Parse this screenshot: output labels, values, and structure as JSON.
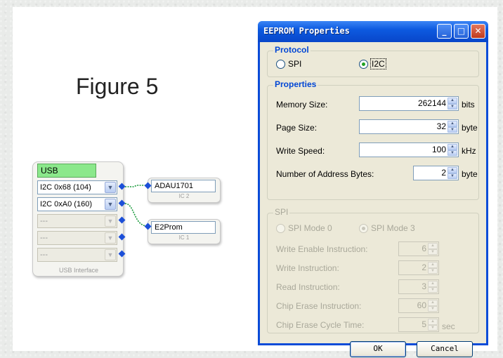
{
  "figure_title": "Figure 5",
  "usb_block": {
    "title": "USB",
    "ports": [
      {
        "label": "I2C 0x68 (104)",
        "enabled": true
      },
      {
        "label": "I2C 0xA0 (160)",
        "enabled": true
      },
      {
        "label": "---",
        "enabled": false
      },
      {
        "label": "---",
        "enabled": false
      },
      {
        "label": "---",
        "enabled": false
      }
    ],
    "caption": "USB Interface"
  },
  "ic_blocks": [
    {
      "name": "ADAU1701",
      "sub": "IC 2"
    },
    {
      "name": "E2Prom",
      "sub": "IC 1"
    }
  ],
  "dialog": {
    "title": "EEPROM Properties",
    "titlebar_buttons": {
      "minimize": "_",
      "maximize": "□",
      "close": "✕"
    },
    "protocol": {
      "label": "Protocol",
      "options": [
        {
          "label": "SPI",
          "selected": false
        },
        {
          "label": "I2C",
          "selected": true
        }
      ]
    },
    "properties": {
      "label": "Properties",
      "fields": [
        {
          "label": "Memory Size:",
          "value": "262144",
          "unit": "bits"
        },
        {
          "label": "Page Size:",
          "value": "32",
          "unit": "byte"
        },
        {
          "label": "Write Speed:",
          "value": "100",
          "unit": "kHz"
        },
        {
          "label": "Number of Address Bytes:",
          "value": "2",
          "unit": "byte"
        }
      ]
    },
    "spi": {
      "label": "SPI",
      "modes": [
        {
          "label": "SPI Mode 0",
          "selected": false
        },
        {
          "label": "SPI Mode 3",
          "selected": true
        }
      ],
      "fields": [
        {
          "label": "Write Enable Instruction:",
          "value": "6",
          "unit": ""
        },
        {
          "label": "Write Instruction:",
          "value": "2",
          "unit": ""
        },
        {
          "label": "Read Instruction:",
          "value": "3",
          "unit": ""
        },
        {
          "label": "Chip Erase Instruction:",
          "value": "60",
          "unit": ""
        },
        {
          "label": "Chip Erase Cycle Time:",
          "value": "5",
          "unit": "sec"
        }
      ]
    },
    "buttons": {
      "ok": "OK",
      "cancel": "Cancel"
    }
  },
  "colors": {
    "titlebar": "#0d5ae0",
    "group_label": "#0046d5",
    "usb_title_bg": "#8be88b",
    "connector": "#1c4fd8",
    "wire": "#1a9a3c"
  }
}
